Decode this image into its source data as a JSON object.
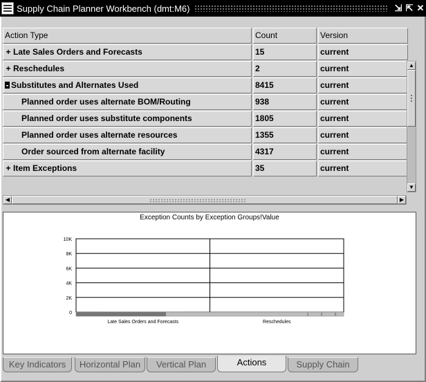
{
  "window": {
    "title": "Supply Chain Planner Workbench (dmt:M6)",
    "controls": {
      "minimize": "⇲",
      "maximize": "⇱",
      "close": "✕"
    }
  },
  "toolbar": {
    "open_icon": "folder-open-icon"
  },
  "grid": {
    "headers": {
      "action_type": "Action Type",
      "count": "Count",
      "version": "Version"
    },
    "rows": [
      {
        "expander": "+",
        "label": "Late Sales Orders and Forecasts",
        "count": "15",
        "version": "current"
      },
      {
        "expander": "+",
        "label": "Reschedules",
        "count": "2",
        "version": "current"
      },
      {
        "expander": "-",
        "label": "Substitutes and Alternates Used",
        "count": "8415",
        "version": "current"
      },
      {
        "expander": "",
        "label": "Planned order uses alternate BOM/Routing",
        "count": "938",
        "version": "current"
      },
      {
        "expander": "",
        "label": "Planned order uses substitute components",
        "count": "1805",
        "version": "current"
      },
      {
        "expander": "",
        "label": "Planned order uses alternate resources",
        "count": "1355",
        "version": "current"
      },
      {
        "expander": "",
        "label": "Order sourced from alternate facility",
        "count": "4317",
        "version": "current"
      },
      {
        "expander": "+",
        "label": "Item Exceptions",
        "count": "35",
        "version": "current"
      }
    ]
  },
  "chart_data": {
    "type": "bar",
    "title": "Exception Counts by Exception Groups!Value",
    "categories": [
      "Late Sales Orders and Forecasts",
      "Reschedules"
    ],
    "values": [
      15,
      2
    ],
    "yticks": [
      "0",
      "2K",
      "4K",
      "6K",
      "8K",
      "10K"
    ],
    "ylim": [
      0,
      10000
    ],
    "scroll_labels": [
      "1",
      "2",
      "3"
    ],
    "grid": true
  },
  "tabs": [
    {
      "label": "Key Indicators",
      "active": false
    },
    {
      "label": "Horizontal Plan",
      "active": false
    },
    {
      "label": "Vertical Plan",
      "active": false
    },
    {
      "label": "Actions",
      "active": true
    },
    {
      "label": "Supply Chain",
      "active": false
    }
  ]
}
